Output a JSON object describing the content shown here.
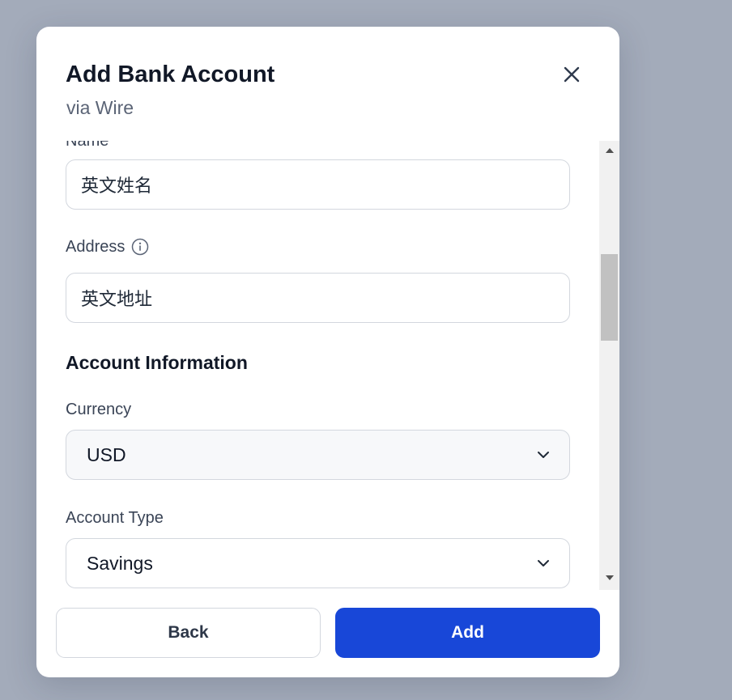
{
  "modal": {
    "title": "Add Bank Account",
    "subtitle": "via Wire",
    "close_icon": "close-icon"
  },
  "form": {
    "name_label": "Name",
    "name_value": "英文姓名",
    "address_label": "Address",
    "address_info_icon": "info-icon",
    "address_value": "英文地址",
    "account_section_title": "Account Information",
    "currency_label": "Currency",
    "currency_value": "USD",
    "account_type_label": "Account Type",
    "account_type_value": "Savings"
  },
  "scrollbar": {
    "up_icon": "arrow-up-icon",
    "down_icon": "arrow-down-icon"
  },
  "footer": {
    "back_label": "Back",
    "add_label": "Add"
  },
  "colors": {
    "backdrop": "#a3abba",
    "primary": "#1847d8",
    "modal_bg": "#ffffff",
    "title_text": "#111827"
  }
}
